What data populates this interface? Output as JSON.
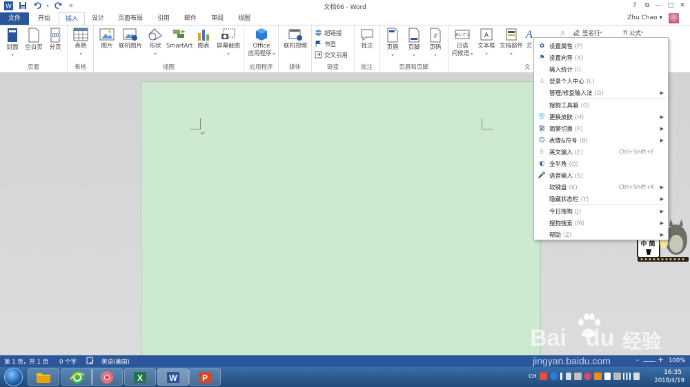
{
  "title_bar": {
    "document_title": "文档66 - Word",
    "help": "?",
    "restore": "⧉",
    "minimize": "—",
    "maximize": "□",
    "close": "✕"
  },
  "tabs": [
    "文件",
    "开始",
    "插入",
    "设计",
    "页面布局",
    "引用",
    "邮件",
    "审阅",
    "视图"
  ],
  "active_tab": "插入",
  "user": {
    "name": "Zhu Chao",
    "dropdown": "▾"
  },
  "ribbon": {
    "groups": {
      "pages": "页面",
      "tables": "表格",
      "illustrations": "插图",
      "apps": "应用程序",
      "media": "媒体",
      "links": "链接",
      "comments": "批注",
      "header_footer": "页眉和页脚",
      "text": "文"
    },
    "buttons": {
      "cover": "封面",
      "blank_page": "空白页",
      "page_break": "分页",
      "table": "表格",
      "picture": "图片",
      "online_picture": "联机图片",
      "shapes": "形状",
      "smartart": "SmartArt",
      "chart": "图表",
      "screenshot": "屏幕截图",
      "office_apps_1": "Office",
      "office_apps_2": "应用程序",
      "online_video": "联机视频",
      "hyperlink": "超链接",
      "bookmark": "书签",
      "cross_ref": "交叉引用",
      "comment": "批注",
      "header": "页眉",
      "footer": "页脚",
      "page_number": "页码",
      "japanese_1": "日语",
      "japanese_2": "问候语",
      "textbox": "文本框",
      "quick_parts": "文档部件",
      "wordart": "艺",
      "signature": "签名行",
      "equation": "公式",
      "japanese_icon": "あいさつ"
    }
  },
  "context_menu": {
    "items": [
      {
        "label": "设置属性",
        "accel": "(P)",
        "icon": "gear-icon",
        "submenu": false
      },
      {
        "label": "设置向导",
        "accel": "(X)",
        "icon": "flag-icon",
        "submenu": false
      },
      {
        "label": "输入统计",
        "accel": "(I)",
        "icon": "",
        "submenu": false
      },
      {
        "label": "登录个人中心",
        "accel": "(L)",
        "icon": "user-icon",
        "submenu": false
      },
      {
        "label": "管理/修复输入法",
        "accel": "(G)",
        "icon": "",
        "submenu": true
      },
      {
        "label": "搜狗工具箱",
        "accel": "(O)",
        "icon": "",
        "submenu": false
      },
      {
        "label": "更换皮肤",
        "accel": "(H)",
        "icon": "shirt-icon",
        "submenu": true
      },
      {
        "label": "简繁切换",
        "accel": "(F)",
        "icon": "convert-icon",
        "submenu": true
      },
      {
        "label": "表情&符号",
        "accel": "(B)",
        "icon": "smiley-icon",
        "submenu": true
      },
      {
        "label": "英文输入",
        "accel": "(E)",
        "icon": "letter-e-icon",
        "shortcut": "Ctrl+Shift+E",
        "submenu": false
      },
      {
        "label": "全半角",
        "accel": "(Q)",
        "icon": "moon-icon",
        "submenu": false
      },
      {
        "label": "语音输入",
        "accel": "(S)",
        "icon": "microphone-icon",
        "submenu": false
      },
      {
        "label": "软键盘",
        "accel": "(K)",
        "icon": "",
        "shortcut": "Ctrl+Shift+K",
        "submenu": true
      },
      {
        "label": "隐藏状态栏",
        "accel": "(Y)",
        "icon": "",
        "submenu": true
      },
      {
        "label": "今日搜狗",
        "accel": "(J)",
        "icon": "",
        "submenu": true
      },
      {
        "label": "搜狗搜索",
        "accel": "(M)",
        "icon": "",
        "submenu": true
      },
      {
        "label": "帮助",
        "accel": "(Z)",
        "icon": "",
        "submenu": true
      }
    ],
    "arrow": "▶"
  },
  "document": {
    "paragraph_mark": "↵"
  },
  "sogou_widget": {
    "mode": "中",
    "punct": "简"
  },
  "status_bar": {
    "page": "第 1 页，共 1 页",
    "words": "0 个字",
    "language": "英语(美国)",
    "zoom": "100%",
    "zoom_minus": "-",
    "zoom_plus": "+"
  },
  "taskbar": {
    "apps": [
      "file-explorer-icon",
      "ie-browser-icon",
      "chrome-icon",
      "excel-icon",
      "word-icon",
      "powerpoint-icon"
    ],
    "tray": {
      "ime": "CH",
      "time": "16:35",
      "date": "2018/4/19"
    }
  },
  "watermark": {
    "logo": "Bai",
    "logo2": "du",
    "cn": "经验",
    "url": "jingyan.baidu.com"
  },
  "colors": {
    "word_blue": "#2b579a",
    "page_green": "#cce8cf"
  }
}
